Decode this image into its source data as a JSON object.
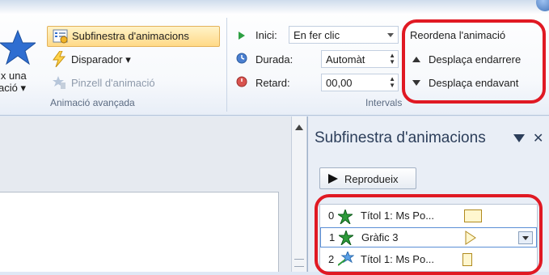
{
  "ribbon": {
    "add_animation": {
      "line1": "ix una",
      "line2": "ació ▾"
    },
    "animation_pane_button": "Subfinestra d'animacions",
    "trigger_button": "Disparador ▾",
    "painter_button": "Pinzell d'animació",
    "advanced_group_label": "Animació avançada",
    "start_label": "Inici:",
    "start_value": "En fer clic",
    "duration_label": "Durada:",
    "duration_value": "Automàt",
    "delay_label": "Retard:",
    "delay_value": "00,00",
    "timing_group_label": "Intervals",
    "reorder_title": "Reordena l'animació",
    "move_earlier": "Desplaça endarrere",
    "move_later": "Desplaça endavant"
  },
  "pane": {
    "title": "Subfinestra d'animacions",
    "play_button": "Reprodueix",
    "items": [
      {
        "num": "0",
        "name": "Títol 1: Ms Po..."
      },
      {
        "num": "1",
        "name": "Gràfic 3"
      },
      {
        "num": "2",
        "name": "Títol 1: Ms Po..."
      }
    ]
  },
  "colors": {
    "highlight_ring": "#e01923",
    "accent_selected": "#5b8fd6"
  },
  "icons": [
    "star-icon",
    "animation-pane-icon",
    "lightning-icon",
    "painter-icon",
    "play-triangle-icon",
    "clock-icon",
    "delay-icon",
    "arrow-up-icon",
    "arrow-down-icon",
    "close-icon",
    "green-burst-icon",
    "dropdown-icon"
  ]
}
